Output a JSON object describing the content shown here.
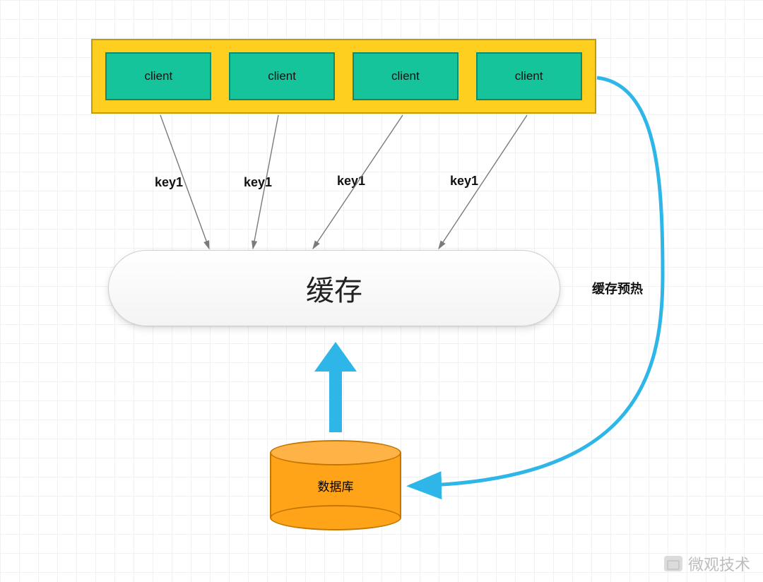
{
  "clients": {
    "labels": [
      "client",
      "client",
      "client",
      "client"
    ]
  },
  "keys": {
    "labels": [
      "key1",
      "key1",
      "key1",
      "key1"
    ]
  },
  "cache": {
    "label": "缓存"
  },
  "database": {
    "label": "数据库"
  },
  "preheat": {
    "label": "缓存预热"
  },
  "watermark": {
    "text": "微观技术"
  },
  "colors": {
    "client_fill": "#16c49c",
    "container_fill": "#ffcf1f",
    "db_fill": "#ffa418",
    "arrow_blue": "#2eb6e8",
    "arrow_gray": "#7a7a7a"
  }
}
